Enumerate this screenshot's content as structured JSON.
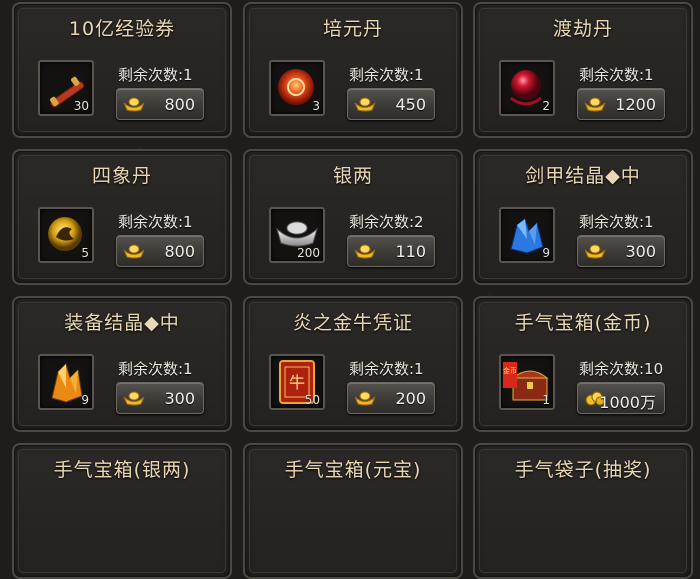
{
  "cards": [
    {
      "title": "10亿经验券",
      "icon": "exp-scroll-icon",
      "qty": "30",
      "remain": "剩余次数:1",
      "currency": "gold-ingot-icon",
      "price": "800"
    },
    {
      "title": "培元丹",
      "icon": "red-pill-icon",
      "qty": "3",
      "remain": "剩余次数:1",
      "currency": "gold-ingot-icon",
      "price": "450"
    },
    {
      "title": "渡劫丹",
      "icon": "red-orb-icon",
      "qty": "2",
      "remain": "剩余次数:1",
      "currency": "gold-ingot-icon",
      "price": "1200"
    },
    {
      "title": "四象丹",
      "icon": "dragon-orb-icon",
      "qty": "5",
      "remain": "剩余次数:1",
      "currency": "gold-ingot-icon",
      "price": "800"
    },
    {
      "title": "银两",
      "icon": "silver-ingot-icon",
      "qty": "200",
      "remain": "剩余次数:2",
      "currency": "gold-ingot-icon",
      "price": "110"
    },
    {
      "title": "剑甲结晶◆中",
      "icon": "blue-crystal-icon",
      "qty": "9",
      "remain": "剩余次数:1",
      "currency": "gold-ingot-icon",
      "price": "300"
    },
    {
      "title": "装备结晶◆中",
      "icon": "orange-crystal-icon",
      "qty": "9",
      "remain": "剩余次数:1",
      "currency": "gold-ingot-icon",
      "price": "300"
    },
    {
      "title": "炎之金牛凭证",
      "icon": "red-token-icon",
      "qty": "50",
      "token_text": "牛",
      "remain": "剩余次数:1",
      "currency": "gold-ingot-icon",
      "price": "200"
    },
    {
      "title": "手气宝箱(金币)",
      "icon": "treasure-chest-icon",
      "qty": "1",
      "badge_text": "金币",
      "remain": "剩余次数:10",
      "currency": "gold-coins-icon",
      "price": "1000万"
    },
    {
      "title": "手气宝箱(银两)"
    },
    {
      "title": "手气宝箱(元宝)"
    },
    {
      "title": "手气袋子(抽奖)"
    }
  ],
  "colors": {
    "title": "#e8d8b6",
    "panel": "#2b2926",
    "border": "#4c4945"
  }
}
